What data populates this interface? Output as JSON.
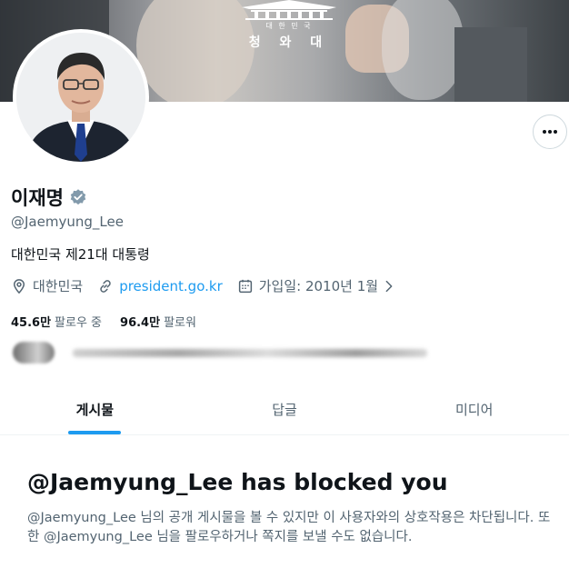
{
  "banner": {
    "emblem_small": "대 한 민 국",
    "emblem_big": "청 와 대"
  },
  "profile": {
    "name": "이재명",
    "handle": "@Jaemyung_Lee",
    "bio": "대한민국 제21대 대통령",
    "location": "대한민국",
    "website": "president.go.kr",
    "joined": "가입일: 2010년 1월",
    "following_count": "45.6만",
    "following_label": "팔로우 중",
    "followers_count": "96.4만",
    "followers_label": "팔로워"
  },
  "icons": {
    "more": "more-horizontal-icon",
    "verified": "verified-badge-icon",
    "location": "location-pin-icon",
    "link": "link-icon",
    "calendar": "calendar-icon",
    "chevron": "chevron-right-icon"
  },
  "tabs": [
    {
      "label": "게시물",
      "active": true
    },
    {
      "label": "답글",
      "active": false
    },
    {
      "label": "미디어",
      "active": false
    }
  ],
  "blocked": {
    "title": "@Jaemyung_Lee has blocked you",
    "message": "@Jaemyung_Lee 님의 공개 게시물을 볼 수 있지만 이 사용자와의 상호작용은 차단됩니다. 또한 @Jaemyung_Lee 님을 팔로우하거나 쪽지를 보낼 수도 없습니다."
  },
  "colors": {
    "accent": "#1d9bf0",
    "text_primary": "#0f1419",
    "text_secondary": "#536471",
    "verified": "#829aab"
  }
}
